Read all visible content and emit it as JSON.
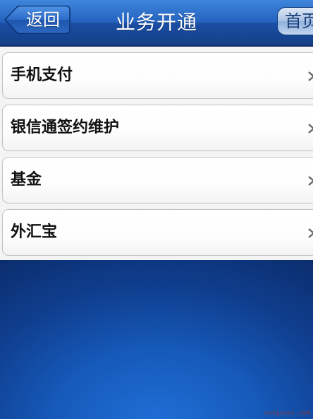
{
  "header": {
    "title": "业务开通",
    "back_label": "返回",
    "home_label": "首页"
  },
  "list": {
    "items": [
      {
        "label": "手机支付"
      },
      {
        "label": "银信通签约维护"
      },
      {
        "label": "基金"
      },
      {
        "label": "外汇宝"
      }
    ]
  },
  "watermark": "xxxgxxxi.com"
}
